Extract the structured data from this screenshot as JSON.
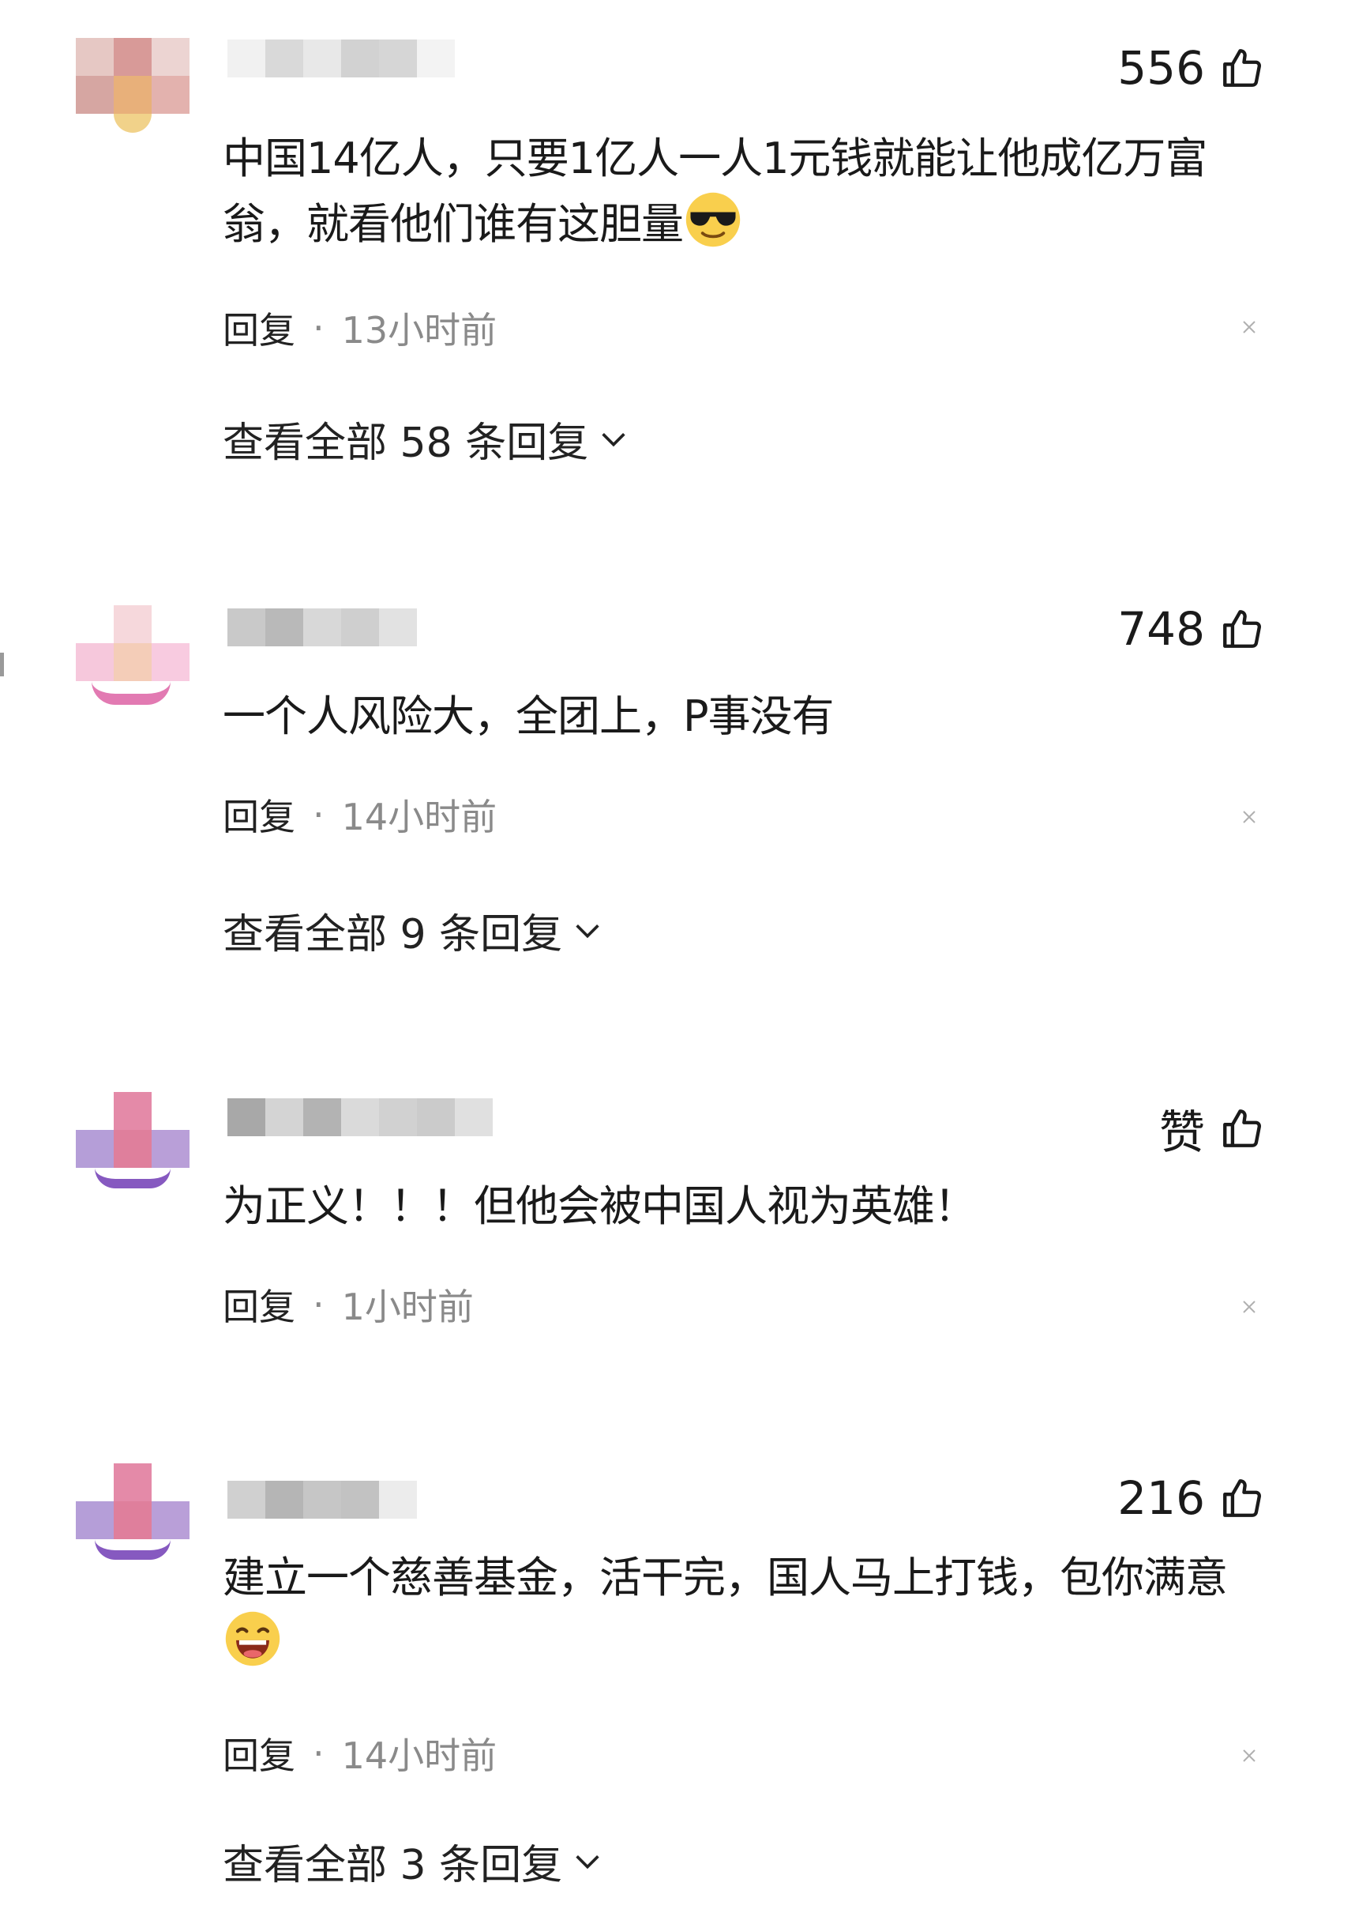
{
  "comments": [
    {
      "likes": "556",
      "text": "中国14亿人，只要1亿人一人1元钱就能让他成亿万富翁，就看他们谁有这胆量",
      "emoji": "sunglasses-emoji",
      "reply_label": "回复",
      "separator": "·",
      "time": "13小时前",
      "view_replies": "查看全部 58 条回复"
    },
    {
      "likes": "748",
      "text": "一个人风险大，全团上，P事没有",
      "reply_label": "回复",
      "separator": "·",
      "time": "14小时前",
      "view_replies": "查看全部 9 条回复"
    },
    {
      "likes": "赞",
      "text": "为正义！！！但他会被中国人视为英雄！",
      "reply_label": "回复",
      "separator": "·",
      "time": "1小时前"
    },
    {
      "likes": "216",
      "text": "建立一个慈善基金，活干完，国人马上打钱，包你满意",
      "emoji": "laughing-emoji",
      "reply_label": "回复",
      "separator": "·",
      "time": "14小时前",
      "view_replies": "查看全部 3 条回复"
    }
  ],
  "icons": {
    "like": "thumbs-up-icon",
    "dismiss": "close-icon",
    "expand": "chevron-down-icon"
  },
  "colors": {
    "text": "#1a1a1a",
    "meta": "#8a8a8a",
    "background": "#ffffff"
  }
}
